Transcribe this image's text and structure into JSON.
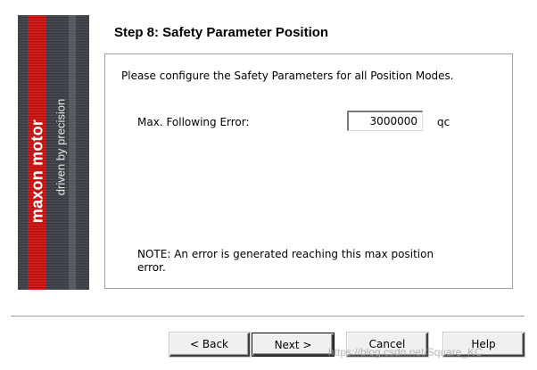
{
  "brand": {
    "name": "maxon motor",
    "tagline": "driven by precision",
    "colors": {
      "red": "#d01010",
      "dark": "#3d4147"
    }
  },
  "step": {
    "title": "Step 8: Safety Parameter Position"
  },
  "panel": {
    "instruction": "Please configure the Safety Parameters for all Position Modes.",
    "max_following_error": {
      "label": "Max. Following Error:",
      "value": "3000000",
      "unit": "qc"
    },
    "note": "NOTE: An error is generated reaching this max position error."
  },
  "buttons": {
    "back": "< Back",
    "next": "Next >",
    "cancel": "Cancel",
    "help": "Help"
  },
  "watermark": "https://blog.csdn.net/Square_KC"
}
